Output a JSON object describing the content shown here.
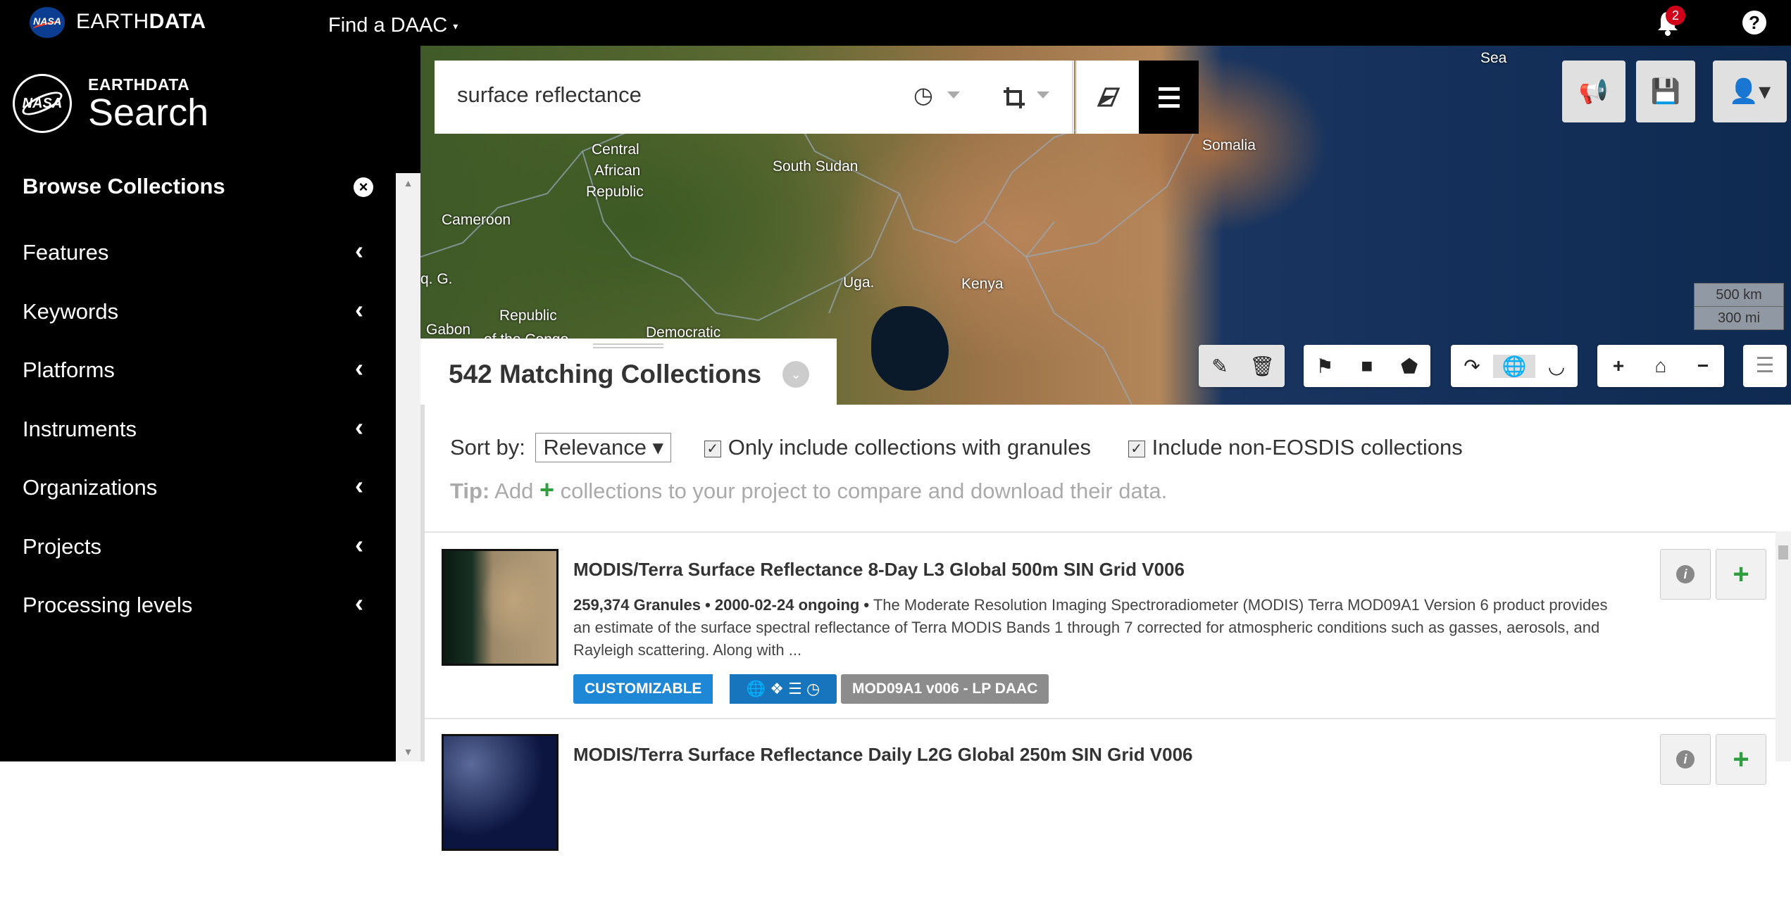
{
  "topbar": {
    "brand_light": "EARTH",
    "brand_bold": "DATA",
    "logo_text": "NASA",
    "find_daac": "Find a DAAC",
    "notifications_count": "2",
    "help": "?"
  },
  "sidebar": {
    "logo_text": "NASA",
    "app_small": "EARTHDATA",
    "app_big": "Search",
    "browse_title": "Browse Collections",
    "facets": [
      {
        "label": "Features"
      },
      {
        "label": "Keywords"
      },
      {
        "label": "Platforms"
      },
      {
        "label": "Instruments"
      },
      {
        "label": "Organizations"
      },
      {
        "label": "Projects"
      },
      {
        "label": "Processing levels"
      }
    ]
  },
  "search": {
    "value": "surface reflectance"
  },
  "map": {
    "places": [
      "Sea",
      "Somalia",
      "Central",
      "African",
      "Republic",
      "South Sudan",
      "Cameroon",
      "q. G.",
      "Uga.",
      "Kenya",
      "Republic",
      "Gabon",
      "of the Congo",
      "Democratic"
    ],
    "scale_km": "500 km",
    "scale_mi": "300 mi"
  },
  "results": {
    "title": "542 Matching Collections",
    "sort_label": "Sort by:",
    "sort_value": "Relevance",
    "only_granules_label": "Only include collections with granules",
    "non_eosdis_label": "Include non-EOSDIS collections",
    "tip_label": "Tip:",
    "tip_before": "Add",
    "tip_after": "collections to your project to compare and download their data.",
    "items": [
      {
        "title": "MODIS/Terra Surface Reflectance 8-Day L3 Global 500m SIN Grid V006",
        "meta_bold": "259,374 Granules • 2000-02-24 ongoing •",
        "description": "The Moderate Resolution Imaging Spectroradiometer (MODIS) Terra MOD09A1 Version 6 product provides an estimate of the surface spectral reflectance of Terra MODIS Bands 1 through 7 corrected for atmospheric conditions such as gasses, aerosols, and Rayleigh scattering. Along with ...",
        "customizable_label": "CUSTOMIZABLE",
        "short_name": "MOD09A1 v006 - LP DAAC"
      },
      {
        "title": "MODIS/Terra Surface Reflectance Daily L2G Global 250m SIN Grid V006"
      }
    ]
  },
  "colors": {
    "accent_blue": "#1e88d6",
    "add_green": "#2e9e3f",
    "badge_red": "#d0021b"
  }
}
